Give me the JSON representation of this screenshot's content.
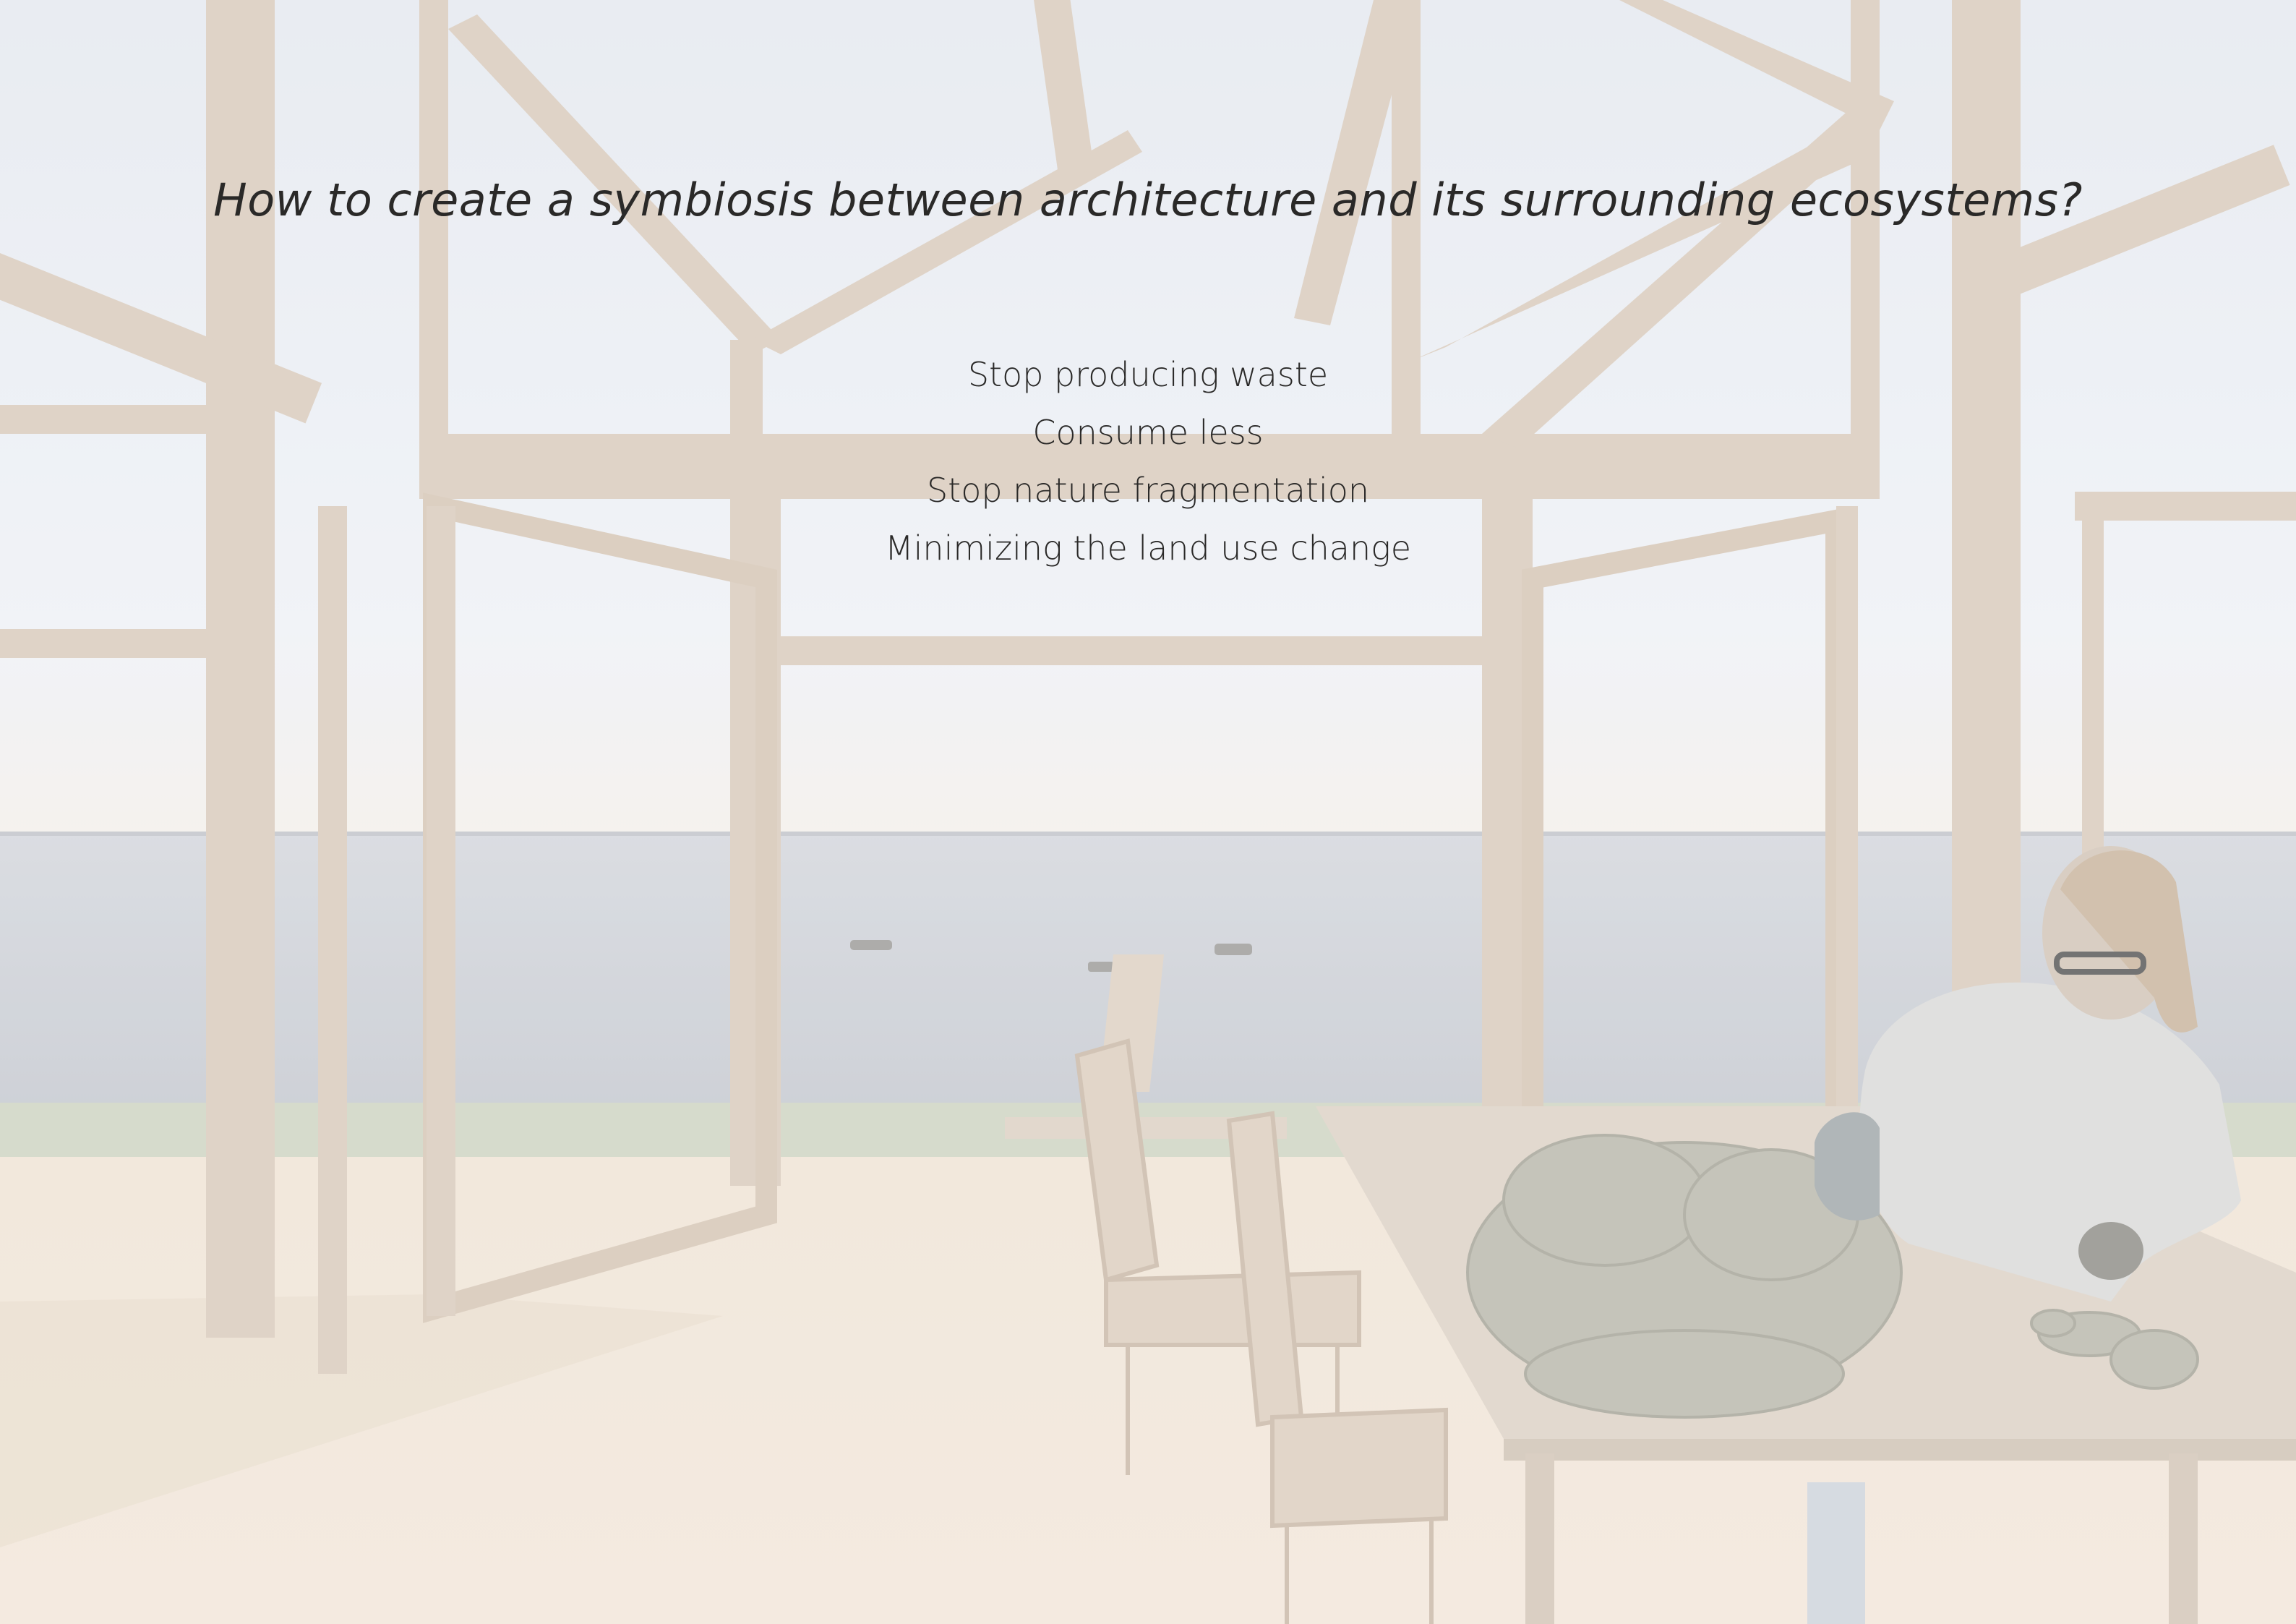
{
  "heading": {
    "question": "How to create a symbiosis between architecture and its surrounding ecosystems?"
  },
  "principles": [
    "Stop producing waste",
    "Consume less",
    "Stop nature fragmentation",
    "Minimizing the land use change"
  ],
  "scene": {
    "description_icons": [
      "timber-frame-structure",
      "sea-horizon",
      "boats",
      "dining-table",
      "chairs",
      "oyster-shell-pile",
      "person-sorting-shells"
    ],
    "colors": {
      "sky": "#e7ebf2",
      "sea": "#c9ccd2",
      "wood": "#d6c8b8",
      "floor": "#f0e4d6",
      "grass": "#cbd3bf"
    }
  }
}
